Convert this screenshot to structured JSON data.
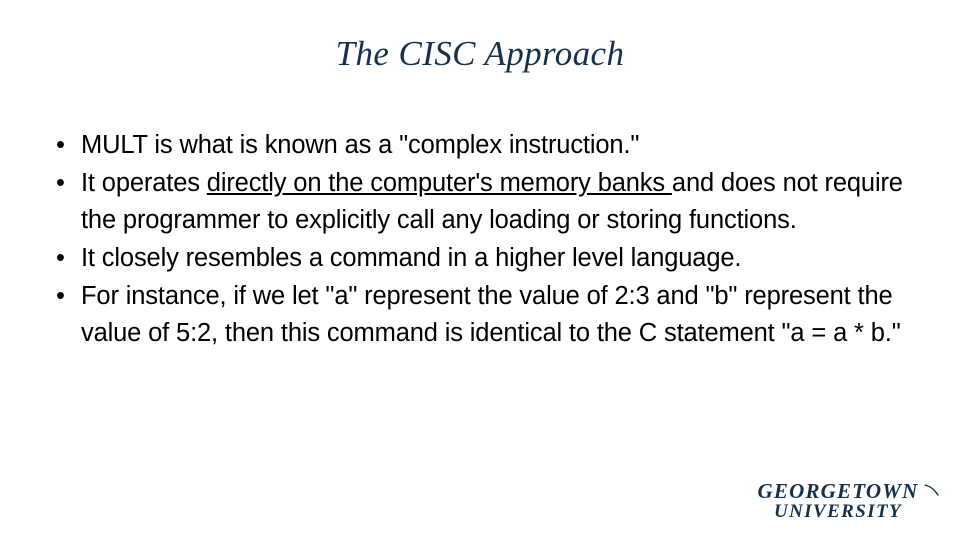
{
  "slide": {
    "title": "The CISC Approach",
    "background_color": "#ffffff",
    "title_color": "#15314b",
    "body_color": "#000000",
    "bullet_marker": "•",
    "bullets": [
      {
        "id": "bullet-mult-complex-instruction",
        "segments": [
          {
            "text": "MULT is what is known as a \"complex instruction.\"",
            "underline": false
          }
        ]
      },
      {
        "id": "bullet-operates-on-memory",
        "segments": [
          {
            "text": "It operates ",
            "underline": false
          },
          {
            "text": "directly on the computer's memory banks ",
            "underline": true
          },
          {
            "text": "and does not require the programmer to explicitly call any loading or storing functions.",
            "underline": false
          }
        ]
      },
      {
        "id": "bullet-resembles-high-level",
        "segments": [
          {
            "text": "It closely resembles a command in a higher level language.",
            "underline": false
          }
        ]
      },
      {
        "id": "bullet-for-instance-example",
        "segments": [
          {
            "text": "For instance, if we let \"a\" represent the value of 2:3 and \"b\" represent the value of 5:2, then this command is identical to the C statement \"a = a * b.\"",
            "underline": false
          }
        ]
      }
    ]
  },
  "logo": {
    "line1": "GEORGETOWN",
    "line2": "UNIVERSITY",
    "color": "#14304b"
  }
}
